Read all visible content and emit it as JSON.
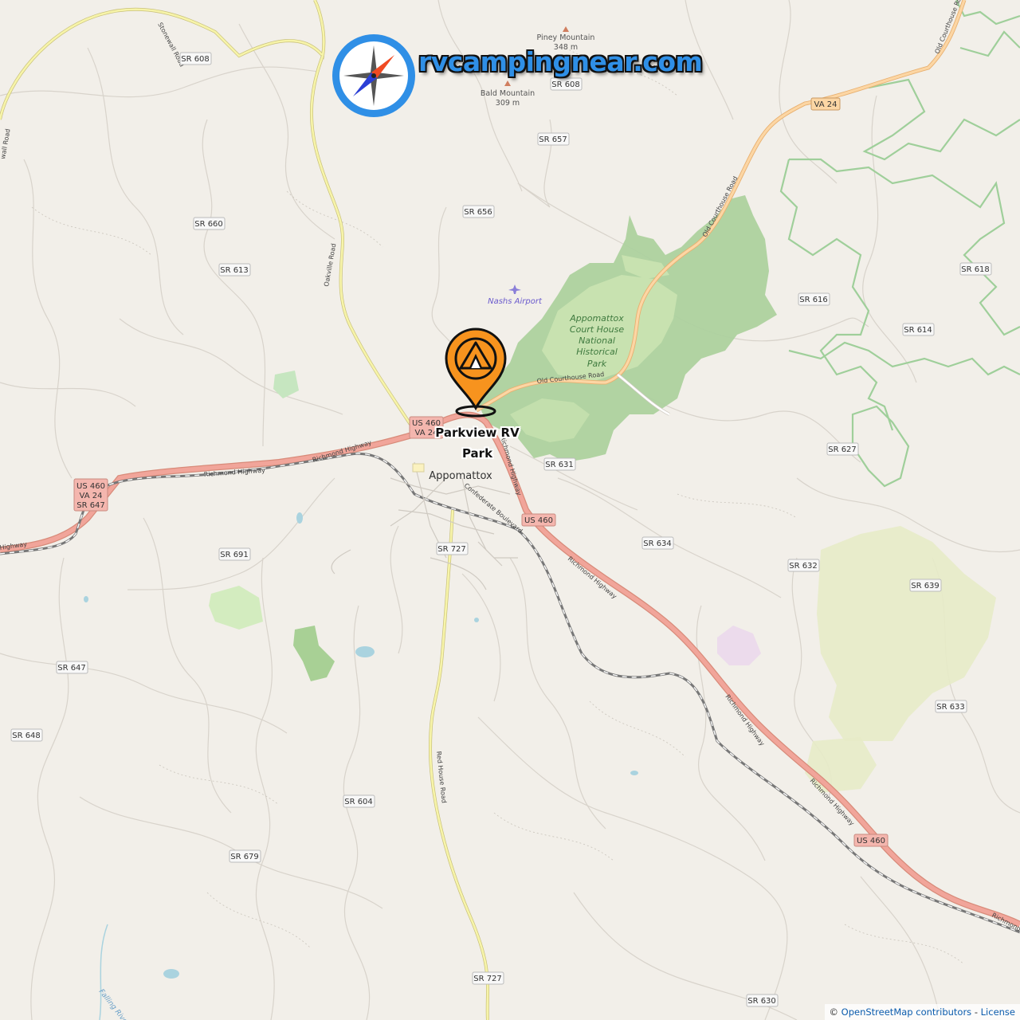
{
  "brand": {
    "text": "rvcampingnear.com"
  },
  "marker": {
    "label": "Parkview RV Park",
    "icon": "campground-tent-pin-icon",
    "color": "#f7931e"
  },
  "town": "Appomattox",
  "park": {
    "lines": [
      "Appomattox",
      "Court House",
      "National",
      "Historical",
      "Park"
    ]
  },
  "airport": "Nashs Airport",
  "peaks": [
    {
      "name": "Piney Mountain",
      "elev": "348 m"
    },
    {
      "name": "Bald Mountain",
      "elev": "309 m"
    }
  ],
  "shields": {
    "sr608a": "SR 608",
    "sr608b": "SR 608",
    "sr657": "SR 657",
    "sr656": "SR 656",
    "sr660": "SR 660",
    "sr613": "SR 613",
    "va24a": "VA 24",
    "sr616": "SR 616",
    "sr618": "SR 618",
    "sr614": "SR 614",
    "sr627": "SR 627",
    "sr631": "SR 631",
    "us460a": "US 460",
    "va24b": "VA 24",
    "us460b": "US 460",
    "va24c": "VA 24",
    "sr647a": "SR 647",
    "sr691": "SR 691",
    "sr727a": "SR 727",
    "sr634": "SR 634",
    "sr632": "SR 632",
    "sr639": "SR 639",
    "sr647b": "SR 647",
    "sr633": "SR 633",
    "sr648": "SR 648",
    "sr604": "SR 604",
    "us460c": "US 460",
    "us460d": "US 460",
    "sr679": "SR 679",
    "sr727b": "SR 727",
    "sr630": "SR 630"
  },
  "roads": {
    "stonewall": "Stonewall Road",
    "oakville": "Oakville Road",
    "oldCourthouse": "Old Courthouse Road",
    "oldCourthouseNE": "Old Courthouse Road",
    "richmond1": "Richmond Highway",
    "richmond2": "Richmond Highway",
    "richmond3": "Richmond Highway",
    "richmond4": "Richmond Highway",
    "richmond5": "Richmond Highway",
    "richmondEdge": "Richmond",
    "highwayEdge": "Highway",
    "confederate": "Confederate Boulevard",
    "redHouse": "Red House Road",
    "nearPin": "Richmond Highway",
    "wallRoad": "wall Road"
  },
  "river": "Falling River",
  "attribution": {
    "prefix": "© ",
    "osm": "OpenStreetMap contributors",
    "sep": " - ",
    "license": "License"
  }
}
